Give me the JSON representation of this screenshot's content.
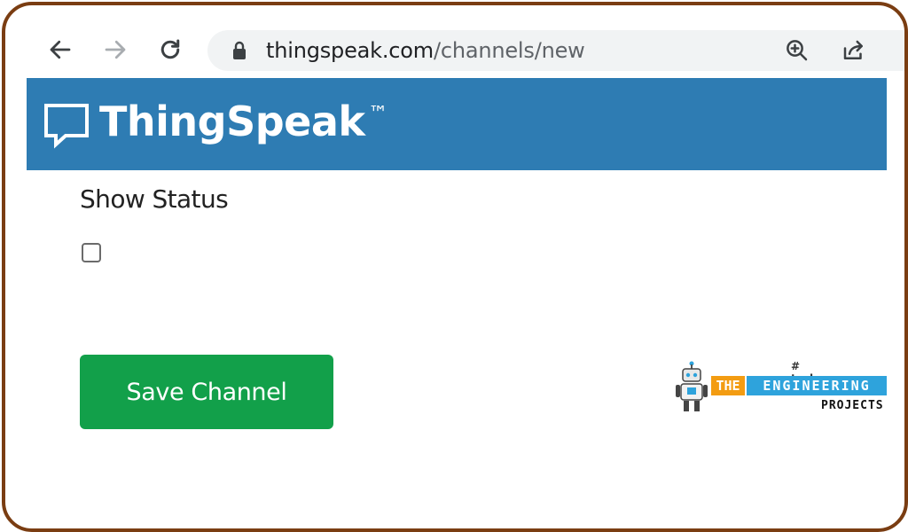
{
  "browser": {
    "back_icon": "arrow-left-icon",
    "forward_icon": "arrow-right-icon",
    "reload_icon": "reload-icon",
    "url_host": "thingspeak.com",
    "url_path": "/channels/new",
    "zoom_icon": "zoom-in-icon",
    "share_icon": "share-icon"
  },
  "header": {
    "brand": "ThingSpeak",
    "trademark": "™",
    "background_color": "#2e7cb3"
  },
  "form": {
    "show_status_label": "Show Status",
    "show_status_checked": false,
    "save_button_label": "Save Channel",
    "save_button_color": "#12a04a"
  },
  "watermark": {
    "tagline": "# technopreneur",
    "the": "THE",
    "engineering": "ENGINEERING",
    "projects": "PROJECTS"
  }
}
